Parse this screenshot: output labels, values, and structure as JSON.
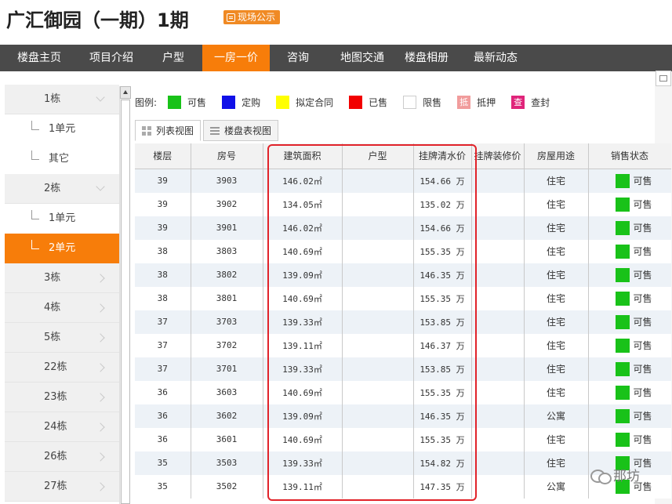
{
  "header": {
    "title": "广汇御园（一期）1期",
    "badge_label": "现场公示"
  },
  "nav": {
    "items": [
      {
        "label": "楼盘主页"
      },
      {
        "label": "项目介绍"
      },
      {
        "label": "户型"
      },
      {
        "label": "一房一价",
        "active": true
      },
      {
        "label": "咨询"
      },
      {
        "label": "地图交通"
      },
      {
        "label": "楼盘相册"
      },
      {
        "label": "最新动态"
      }
    ]
  },
  "sidebar": {
    "items": [
      {
        "label": "1栋",
        "type": "building",
        "chevron": "down"
      },
      {
        "label": "1单元",
        "type": "unit"
      },
      {
        "label": "其它",
        "type": "unit"
      },
      {
        "label": "2栋",
        "type": "building",
        "chevron": "down"
      },
      {
        "label": "1单元",
        "type": "unit"
      },
      {
        "label": "2单元",
        "type": "unit",
        "active": true
      },
      {
        "label": "3栋",
        "type": "building",
        "chevron": "right"
      },
      {
        "label": "4栋",
        "type": "building",
        "chevron": "right"
      },
      {
        "label": "5栋",
        "type": "building",
        "chevron": "right"
      },
      {
        "label": "22栋",
        "type": "building",
        "chevron": "right"
      },
      {
        "label": "23栋",
        "type": "building",
        "chevron": "right"
      },
      {
        "label": "24栋",
        "type": "building",
        "chevron": "right"
      },
      {
        "label": "26栋",
        "type": "building",
        "chevron": "right"
      },
      {
        "label": "27栋",
        "type": "building",
        "chevron": "right"
      }
    ]
  },
  "legend": {
    "title": "图例:",
    "items": [
      {
        "label": "可售",
        "color": "#19c219",
        "glyph": ""
      },
      {
        "label": "定购",
        "color": "#1010e8",
        "glyph": ""
      },
      {
        "label": "拟定合同",
        "color": "#ffff00",
        "glyph": ""
      },
      {
        "label": "已售",
        "color": "#f20000",
        "glyph": ""
      },
      {
        "label": "限售",
        "color": "#ffffff",
        "glyph": ""
      },
      {
        "label": "抵押",
        "color": "#f19c9c",
        "glyph": "抵"
      },
      {
        "label": "查封",
        "color": "#e0247a",
        "glyph": "查"
      }
    ]
  },
  "view_tabs": {
    "list_label": "列表视图",
    "table_label": "楼盘表视图"
  },
  "table": {
    "headers": [
      "楼层",
      "房号",
      "建筑面积",
      "户型",
      "挂牌清水价",
      "挂牌装修价",
      "房屋用途",
      "销售状态"
    ],
    "rows": [
      {
        "floor": "39",
        "room": "3903",
        "area": "146.02㎡",
        "layout": "",
        "price": "154.66 万",
        "deco_price": "",
        "usage": "住宅",
        "status": "可售"
      },
      {
        "floor": "39",
        "room": "3902",
        "area": "134.05㎡",
        "layout": "",
        "price": "135.02 万",
        "deco_price": "",
        "usage": "住宅",
        "status": "可售"
      },
      {
        "floor": "39",
        "room": "3901",
        "area": "146.02㎡",
        "layout": "",
        "price": "154.66 万",
        "deco_price": "",
        "usage": "住宅",
        "status": "可售"
      },
      {
        "floor": "38",
        "room": "3803",
        "area": "140.69㎡",
        "layout": "",
        "price": "155.35 万",
        "deco_price": "",
        "usage": "住宅",
        "status": "可售"
      },
      {
        "floor": "38",
        "room": "3802",
        "area": "139.09㎡",
        "layout": "",
        "price": "146.35 万",
        "deco_price": "",
        "usage": "住宅",
        "status": "可售"
      },
      {
        "floor": "38",
        "room": "3801",
        "area": "140.69㎡",
        "layout": "",
        "price": "155.35 万",
        "deco_price": "",
        "usage": "住宅",
        "status": "可售"
      },
      {
        "floor": "37",
        "room": "3703",
        "area": "139.33㎡",
        "layout": "",
        "price": "153.85 万",
        "deco_price": "",
        "usage": "住宅",
        "status": "可售"
      },
      {
        "floor": "37",
        "room": "3702",
        "area": "139.11㎡",
        "layout": "",
        "price": "146.37 万",
        "deco_price": "",
        "usage": "住宅",
        "status": "可售"
      },
      {
        "floor": "37",
        "room": "3701",
        "area": "139.33㎡",
        "layout": "",
        "price": "153.85 万",
        "deco_price": "",
        "usage": "住宅",
        "status": "可售"
      },
      {
        "floor": "36",
        "room": "3603",
        "area": "140.69㎡",
        "layout": "",
        "price": "155.35 万",
        "deco_price": "",
        "usage": "住宅",
        "status": "可售"
      },
      {
        "floor": "36",
        "room": "3602",
        "area": "139.09㎡",
        "layout": "",
        "price": "146.35 万",
        "deco_price": "",
        "usage": "公寓",
        "status": "可售"
      },
      {
        "floor": "36",
        "room": "3601",
        "area": "140.69㎡",
        "layout": "",
        "price": "155.35 万",
        "deco_price": "",
        "usage": "住宅",
        "status": "可售"
      },
      {
        "floor": "35",
        "room": "3503",
        "area": "139.33㎡",
        "layout": "",
        "price": "154.82 万",
        "deco_price": "",
        "usage": "住宅",
        "status": "可售"
      },
      {
        "floor": "35",
        "room": "3502",
        "area": "139.11㎡",
        "layout": "",
        "price": "147.35 万",
        "deco_price": "",
        "usage": "公寓",
        "status": "可售"
      }
    ],
    "status_color": "#19c219"
  },
  "watermark": {
    "text": "那坊"
  },
  "colors": {
    "accent": "#f77d0a",
    "nav_bg": "#4a4a4a",
    "highlight": "#e1232a"
  }
}
